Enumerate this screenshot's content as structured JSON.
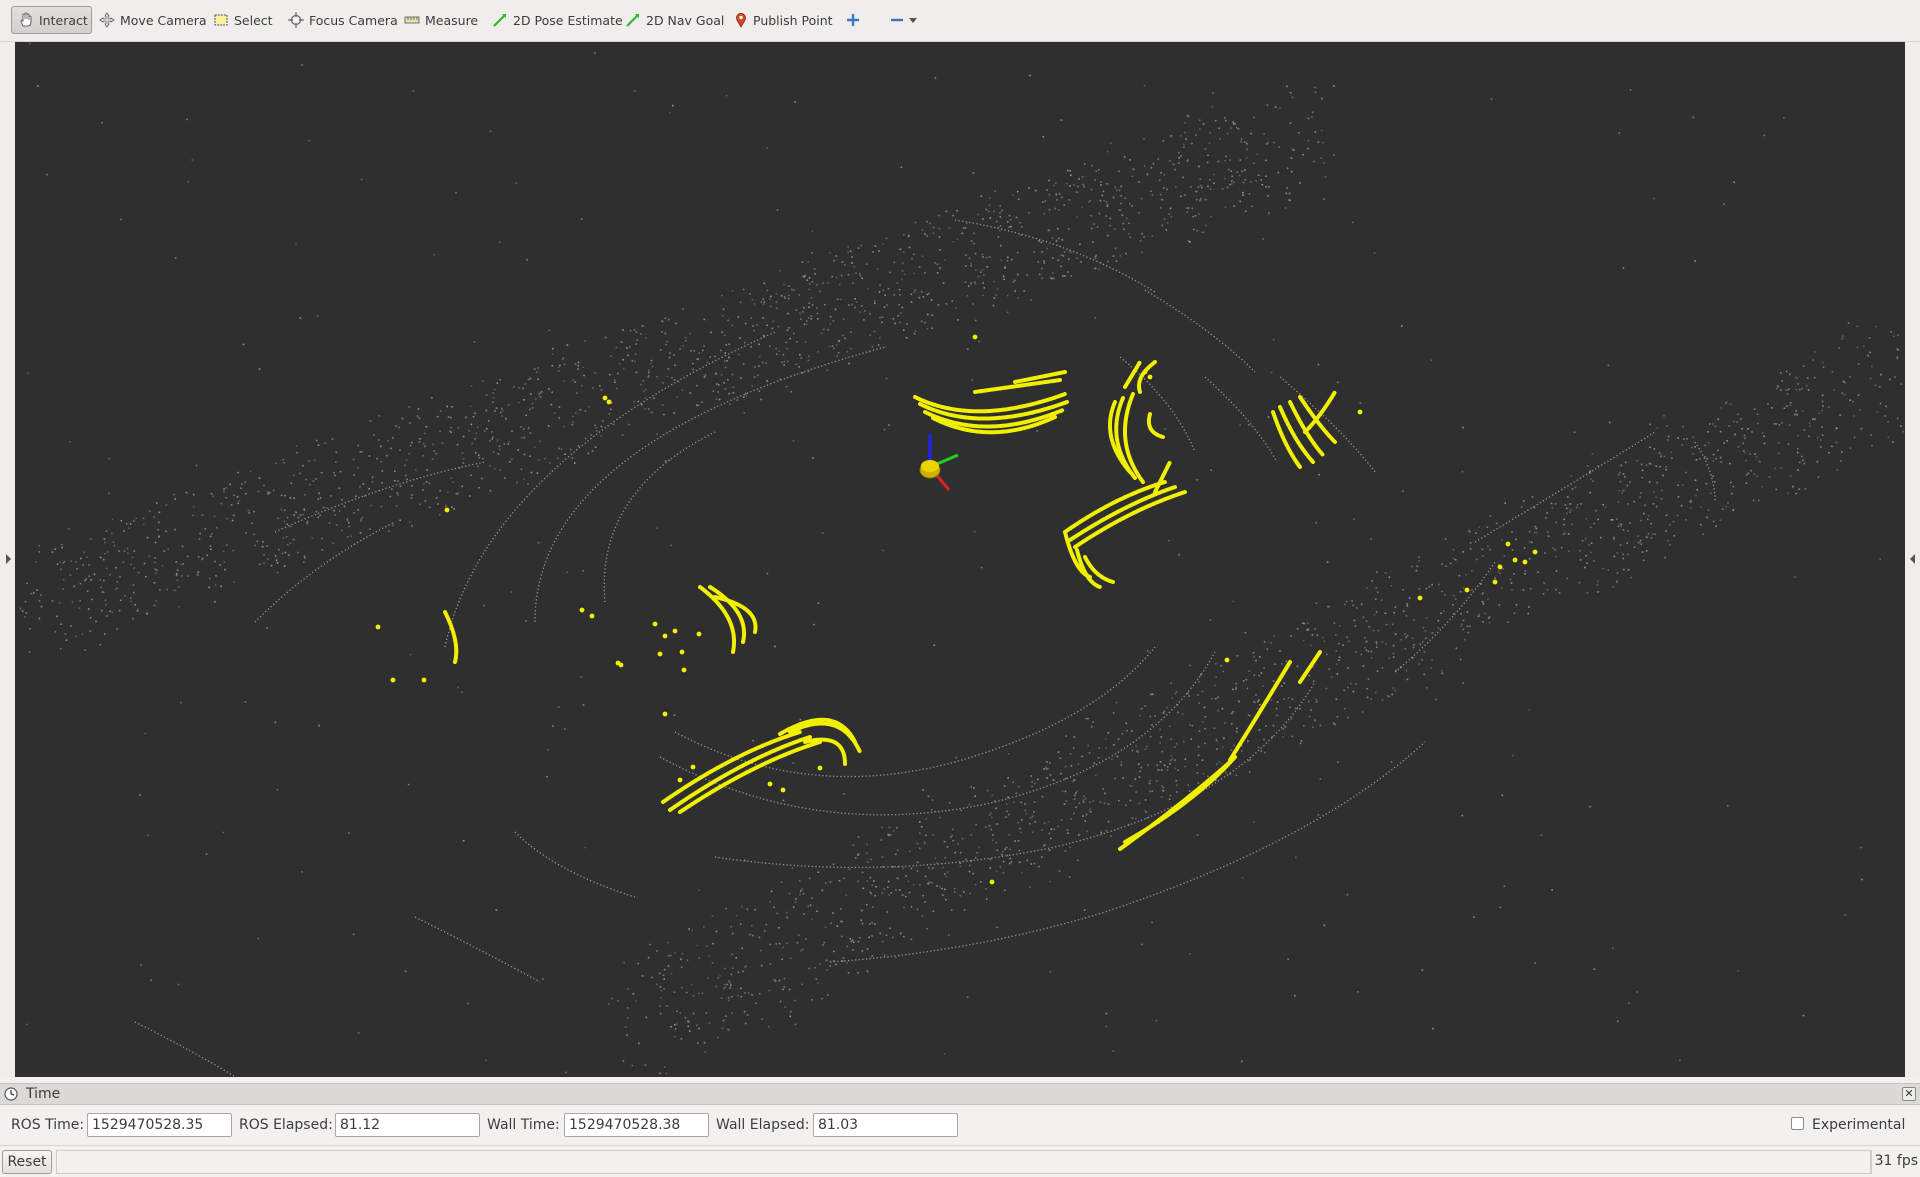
{
  "toolbar": {
    "tools": [
      {
        "label": "Interact",
        "icon": "hand-icon",
        "active": true
      },
      {
        "label": "Move Camera",
        "icon": "move-camera-icon"
      },
      {
        "label": "Select",
        "icon": "select-box-icon"
      },
      {
        "label": "Focus Camera",
        "icon": "focus-crosshair-icon"
      },
      {
        "label": "Measure",
        "icon": "ruler-icon"
      },
      {
        "label": "2D Pose Estimate",
        "icon": "green-arrow-icon"
      },
      {
        "label": "2D Nav Goal",
        "icon": "green-arrow-icon"
      },
      {
        "label": "Publish Point",
        "icon": "map-pin-icon"
      }
    ],
    "add_tool_icon": "plus-icon",
    "remove_tool_icon": "minus-icon"
  },
  "viewport": {
    "background_color": "#2f2f2f",
    "points_color": "#f0f000",
    "scan_color": "#9a9a9a",
    "axis_colors": {
      "x": "#e02020",
      "y": "#20d020",
      "z": "#2020ff"
    }
  },
  "time_panel": {
    "title": "Time",
    "ros_time_label": "ROS Time:",
    "ros_time_value": "1529470528.35",
    "ros_elapsed_label": "ROS Elapsed:",
    "ros_elapsed_value": "81.12",
    "wall_time_label": "Wall Time:",
    "wall_time_value": "1529470528.38",
    "wall_elapsed_label": "Wall Elapsed:",
    "wall_elapsed_value": "81.03",
    "experimental_label": "Experimental",
    "experimental_checked": false
  },
  "status_bar": {
    "reset_label": "Reset",
    "fps": "31 fps"
  }
}
